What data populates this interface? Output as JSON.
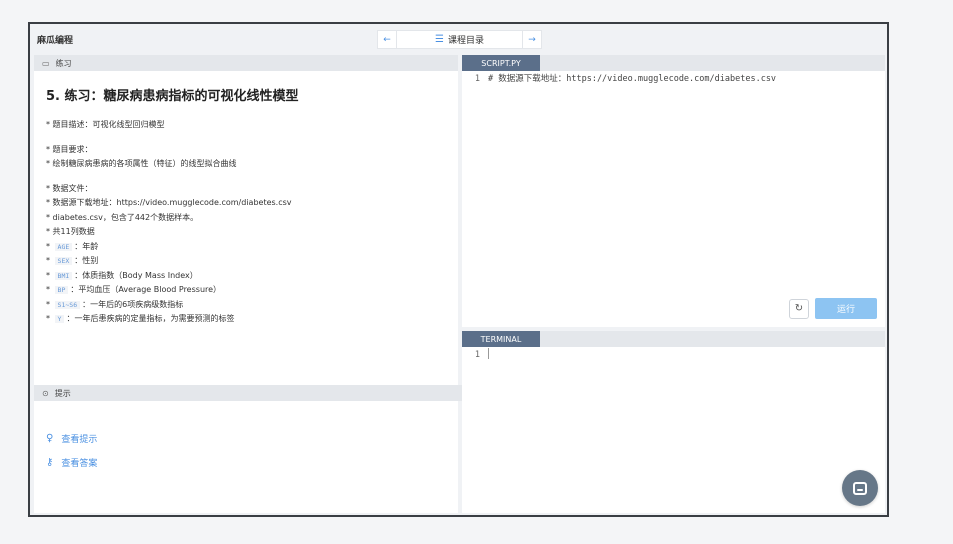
{
  "header": {
    "app_title": "麻瓜编程",
    "prev_icon": "arrow-left-icon",
    "prev_glyph": "←",
    "next_glyph": "→",
    "menu_glyph": "☰",
    "course_catalog_label": "课程目录"
  },
  "exercise": {
    "section_label": "练习",
    "title": "5. 练习：糖尿病患病指标的可视化线性模型",
    "description": "* 题目描述：可视化线型回归模型",
    "requirements_heading": "* 题目要求：",
    "requirement_1": "* 绘制糖尿病患病的各项属性（特征）的线型拟合曲线",
    "data_heading": "* 数据文件：",
    "data_url_line": "* 数据源下载地址：https://video.mugglecode.com/diabetes.csv",
    "data_file_line": "* diabetes.csv，包含了442个数据样本。",
    "columns_line": "* 共11列数据",
    "fields": [
      {
        "tag": "AGE",
        "desc": "：年龄"
      },
      {
        "tag": "SEX",
        "desc": "：性别"
      },
      {
        "tag": "BMI",
        "desc": "：体质指数（Body Mass Index）"
      },
      {
        "tag": "BP",
        "desc": "：平均血压（Average Blood Pressure）"
      },
      {
        "tag": "S1~S6",
        "desc": "：一年后的6项疾病级数指标"
      },
      {
        "tag": "Y",
        "desc": "：一年后患疾病的定量指标，为需要预测的标签"
      }
    ]
  },
  "hints": {
    "section_label": "提示",
    "view_hint": "查看提示",
    "view_answer": "查看答案"
  },
  "editor": {
    "tab_label": "SCRIPT.PY",
    "lines": [
      {
        "no": "1",
        "text": "# 数据源下载地址：https://video.mugglecode.com/diabetes.csv"
      }
    ],
    "run_label": "运行",
    "refresh_glyph": "↻"
  },
  "terminal": {
    "tab_label": "TERMINAL",
    "line_no": "1"
  },
  "colors": {
    "accent": "#4a90e2",
    "tab_active": "#5b6f8a",
    "run_button": "#8dc4f2"
  }
}
